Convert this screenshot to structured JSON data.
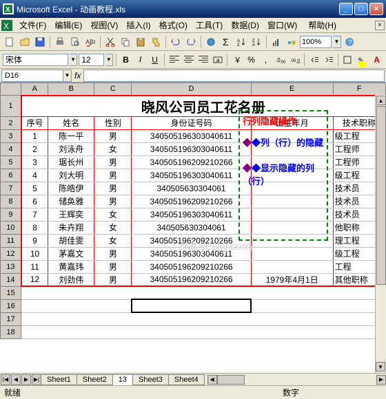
{
  "window": {
    "title": "Microsoft Excel - 动画教程.xls"
  },
  "menu": {
    "file": "文件(F)",
    "edit": "编辑(E)",
    "view": "视图(V)",
    "insert": "插入(I)",
    "format": "格式(O)",
    "tools": "工具(T)",
    "data": "数据(D)",
    "window": "窗口(W)",
    "help": "帮助(H)"
  },
  "toolbar": {
    "zoom": "100%"
  },
  "formatbar": {
    "font": "宋体",
    "size": "12"
  },
  "namebox": "D16",
  "columns": [
    "A",
    "B",
    "C",
    "D",
    "E",
    "F"
  ],
  "title_row": "晓风公司员工花名册",
  "headers": {
    "a": "序号",
    "b": "姓名",
    "c": "性别",
    "d": "身份证号码",
    "e": "出生年月",
    "f": "技术职称"
  },
  "rows": [
    {
      "n": "1",
      "name": "陈一平",
      "sex": "男",
      "id": "340505196303040611",
      "dob": "",
      "tit": "级工程"
    },
    {
      "n": "2",
      "name": "刘泳舟",
      "sex": "女",
      "id": "340505196303040611",
      "dob": "",
      "tit": "工程师"
    },
    {
      "n": "3",
      "name": "琚长州",
      "sex": "男",
      "id": "340505196209210266",
      "dob": "",
      "tit": "工程师"
    },
    {
      "n": "4",
      "name": "刘大明",
      "sex": "男",
      "id": "340505196303040611",
      "dob": "",
      "tit": "级工程"
    },
    {
      "n": "5",
      "name": "陈皓伊",
      "sex": "男",
      "id": "340505630304061",
      "dob": "",
      "tit": "技术员"
    },
    {
      "n": "6",
      "name": "储奂雅",
      "sex": "男",
      "id": "340505196209210266",
      "dob": "",
      "tit": "技术员"
    },
    {
      "n": "7",
      "name": "王辉奕",
      "sex": "女",
      "id": "340505196303040611",
      "dob": "",
      "tit": "技术员"
    },
    {
      "n": "8",
      "name": "朱卉翔",
      "sex": "女",
      "id": "340505630304061",
      "dob": "",
      "tit": "他职称"
    },
    {
      "n": "9",
      "name": "胡佳雯",
      "sex": "女",
      "id": "340505196209210266",
      "dob": "",
      "tit": "理工程"
    },
    {
      "n": "10",
      "name": "茅嘉文",
      "sex": "男",
      "id": "340505196303040611",
      "dob": "",
      "tit": "级工程"
    },
    {
      "n": "11",
      "name": "黄嘉玮",
      "sex": "男",
      "id": "340505196209210266",
      "dob": "",
      "tit": "工程"
    },
    {
      "n": "12",
      "name": "刘劲伟",
      "sex": "男",
      "id": "340505196209210266",
      "dob": "1979年4月1日",
      "tit": "其他职称"
    }
  ],
  "overlay": {
    "line1": "行列隐藏操作",
    "line2": "◆列（行）的隐藏",
    "line3": "◆显示隐藏的列（行）"
  },
  "watermark": "soft.yesky.com",
  "tabs": {
    "nav": [
      "|◀",
      "◀",
      "▶",
      "▶|"
    ],
    "sheets": [
      "Sheet1",
      "Sheet2",
      "13",
      "Sheet3",
      "Sheet4"
    ]
  },
  "status": {
    "ready": "就绪",
    "mode": "数字"
  }
}
